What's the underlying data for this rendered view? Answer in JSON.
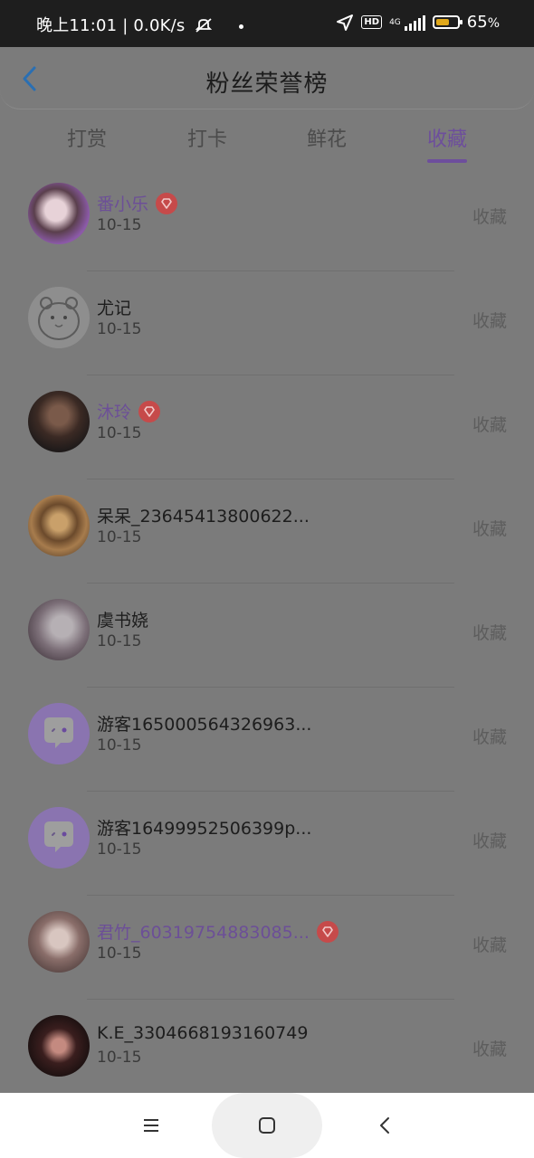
{
  "status_bar": {
    "time_text": "晚上11:01 | 0.0K/s",
    "network_tag": "4G",
    "hd_tag": "HD",
    "battery_percent": "65",
    "battery_unit": "%",
    "battery_level": 0.65,
    "battery_color": "#e0a81a"
  },
  "header": {
    "title": "粉丝荣誉榜"
  },
  "tabs": [
    {
      "label": "打赏"
    },
    {
      "label": "打卡"
    },
    {
      "label": "鲜花"
    },
    {
      "label": "收藏"
    }
  ],
  "active_tab_index": 3,
  "accent_color": "#6d4e9c",
  "vip_badge_color": "#c64a4a",
  "list": [
    {
      "name": "番小乐",
      "date": "10-15",
      "action": "收藏",
      "vip": true,
      "avatar_icon": "user-photo-icon"
    },
    {
      "name": "尤记",
      "date": "10-15",
      "action": "收藏",
      "vip": false,
      "avatar_icon": "hamster-sketch-icon"
    },
    {
      "name": "沐玲",
      "date": "10-15",
      "action": "收藏",
      "vip": true,
      "avatar_icon": "user-photo-icon"
    },
    {
      "name": "呆呆_23645413800622...",
      "date": "10-15",
      "action": "收藏",
      "vip": false,
      "avatar_icon": "cat-photo-icon"
    },
    {
      "name": "虞书娆",
      "date": "10-15",
      "action": "收藏",
      "vip": false,
      "avatar_icon": "user-photo-icon"
    },
    {
      "name": "游客165000564326963...",
      "date": "10-15",
      "action": "收藏",
      "vip": false,
      "avatar_icon": "chat-bubble-icon"
    },
    {
      "name": "游客16499952506399p...",
      "date": "10-15",
      "action": "收藏",
      "vip": false,
      "avatar_icon": "chat-bubble-icon"
    },
    {
      "name": "君竹_60319754883085...",
      "date": "10-15",
      "action": "收藏",
      "vip": true,
      "avatar_icon": "user-photo-icon"
    },
    {
      "name": "K.E_3304668193160749",
      "date": "10-15",
      "action": "收藏",
      "vip": false,
      "avatar_icon": "user-photo-icon"
    }
  ]
}
